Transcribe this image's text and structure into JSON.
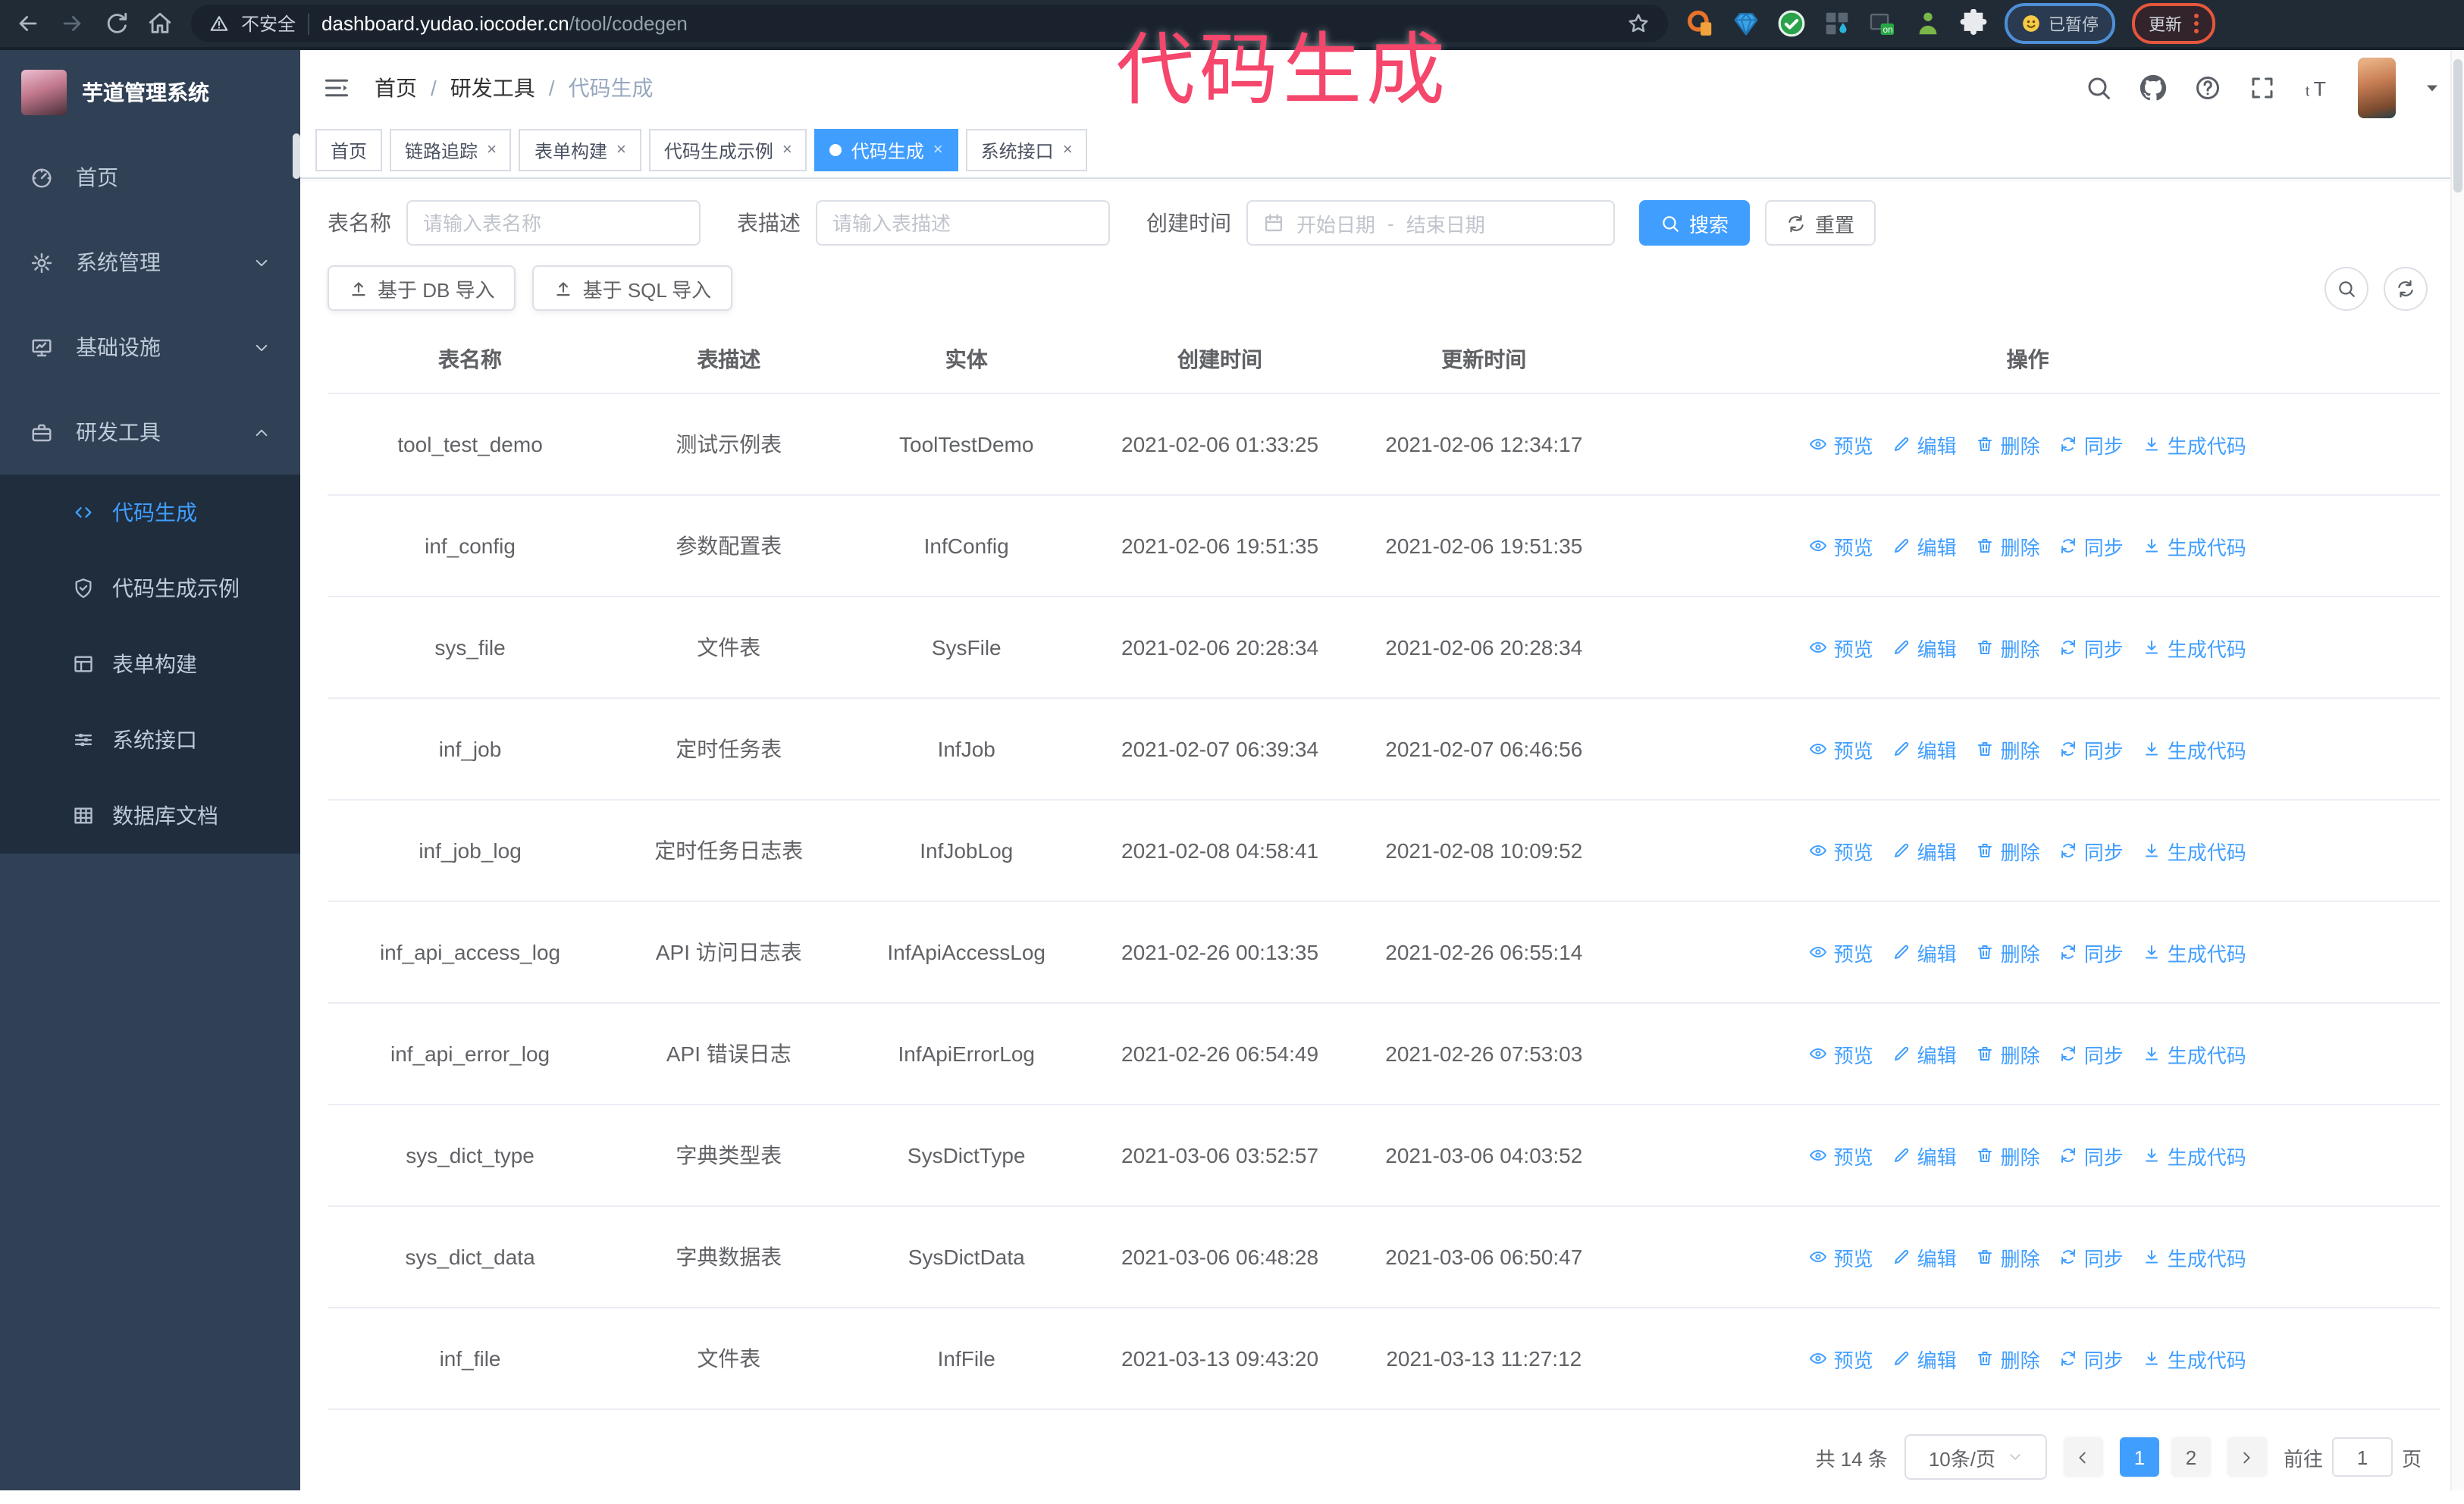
{
  "overlay": {
    "title": "代码生成"
  },
  "browser": {
    "security_label": "不安全",
    "url_host": "dashboard.yudao.iocoder.cn",
    "url_path": "/tool/codegen",
    "paused_badge": "已暂停",
    "update_button": "更新",
    "nav_icons": [
      "back-icon",
      "forward-icon",
      "reload-icon",
      "home-icon"
    ],
    "extension_icons": [
      "ext-orange-icon",
      "gem-icon",
      "check-badge-icon",
      "grid-drop-icon",
      "on-box-icon",
      "green-figure-icon",
      "puzzle-icon"
    ]
  },
  "sidebar": {
    "app_title": "芋道管理系统",
    "items": [
      {
        "key": "home",
        "label": "首页",
        "icon": "dashboard-icon",
        "chevron": ""
      },
      {
        "key": "system-mgmt",
        "label": "系统管理",
        "icon": "gear-icon",
        "chevron": "down"
      },
      {
        "key": "infrastructure",
        "label": "基础设施",
        "icon": "monitor-icon",
        "chevron": "down"
      },
      {
        "key": "dev-tools",
        "label": "研发工具",
        "icon": "toolbox-icon",
        "chevron": "up"
      }
    ],
    "subitems": [
      {
        "key": "codegen",
        "label": "代码生成",
        "icon": "code-icon",
        "active": true
      },
      {
        "key": "codegen-example",
        "label": "代码生成示例",
        "icon": "shield-check-icon",
        "active": false
      },
      {
        "key": "form-builder",
        "label": "表单构建",
        "icon": "form-icon",
        "active": false
      },
      {
        "key": "system-api",
        "label": "系统接口",
        "icon": "sliders-icon",
        "active": false
      },
      {
        "key": "db-doc",
        "label": "数据库文档",
        "icon": "database-icon",
        "active": false
      }
    ]
  },
  "header": {
    "breadcrumb": [
      "首页",
      "研发工具",
      "代码生成"
    ]
  },
  "tabs": [
    {
      "key": "home",
      "label": "首页",
      "closable": false,
      "active": false
    },
    {
      "key": "tracing",
      "label": "链路追踪",
      "closable": true,
      "active": false
    },
    {
      "key": "form-builder",
      "label": "表单构建",
      "closable": true,
      "active": false
    },
    {
      "key": "codegen-example",
      "label": "代码生成示例",
      "closable": true,
      "active": false
    },
    {
      "key": "codegen",
      "label": "代码生成",
      "closable": true,
      "active": true
    },
    {
      "key": "system-api",
      "label": "系统接口",
      "closable": true,
      "active": false
    }
  ],
  "filters": {
    "table_name_label": "表名称",
    "table_name_placeholder": "请输入表名称",
    "table_desc_label": "表描述",
    "table_desc_placeholder": "请输入表描述",
    "create_time_label": "创建时间",
    "start_placeholder": "开始日期",
    "range_separator": "-",
    "end_placeholder": "结束日期",
    "search_label": "搜索",
    "reset_label": "重置"
  },
  "toolbar": {
    "db_import_label": "基于 DB 导入",
    "sql_import_label": "基于 SQL 导入"
  },
  "table": {
    "headers": [
      "表名称",
      "表描述",
      "实体",
      "创建时间",
      "更新时间",
      "操作"
    ],
    "actions": [
      {
        "key": "preview",
        "label": "预览",
        "icon": "eye-icon"
      },
      {
        "key": "edit",
        "label": "编辑",
        "icon": "pencil-icon"
      },
      {
        "key": "delete",
        "label": "删除",
        "icon": "trash-icon"
      },
      {
        "key": "sync",
        "label": "同步",
        "icon": "sync-icon"
      },
      {
        "key": "generate-code",
        "label": "生成代码",
        "icon": "download-icon"
      }
    ],
    "rows": [
      {
        "name": "tool_test_demo",
        "desc": "测试示例表",
        "entity": "ToolTestDemo",
        "created": "2021-02-06 01:33:25",
        "updated": "2021-02-06 12:34:17"
      },
      {
        "name": "inf_config",
        "desc": "参数配置表",
        "entity": "InfConfig",
        "created": "2021-02-06 19:51:35",
        "updated": "2021-02-06 19:51:35"
      },
      {
        "name": "sys_file",
        "desc": "文件表",
        "entity": "SysFile",
        "created": "2021-02-06 20:28:34",
        "updated": "2021-02-06 20:28:34"
      },
      {
        "name": "inf_job",
        "desc": "定时任务表",
        "entity": "InfJob",
        "created": "2021-02-07 06:39:34",
        "updated": "2021-02-07 06:46:56"
      },
      {
        "name": "inf_job_log",
        "desc": "定时任务日志表",
        "entity": "InfJobLog",
        "created": "2021-02-08 04:58:41",
        "updated": "2021-02-08 10:09:52"
      },
      {
        "name": "inf_api_access_log",
        "desc": "API 访问日志表",
        "entity": "InfApiAccessLog",
        "created": "2021-02-26 00:13:35",
        "updated": "2021-02-26 06:55:14"
      },
      {
        "name": "inf_api_error_log",
        "desc": "API 错误日志",
        "entity": "InfApiErrorLog",
        "created": "2021-02-26 06:54:49",
        "updated": "2021-02-26 07:53:03"
      },
      {
        "name": "sys_dict_type",
        "desc": "字典类型表",
        "entity": "SysDictType",
        "created": "2021-03-06 03:52:57",
        "updated": "2021-03-06 04:03:52"
      },
      {
        "name": "sys_dict_data",
        "desc": "字典数据表",
        "entity": "SysDictData",
        "created": "2021-03-06 06:48:28",
        "updated": "2021-03-06 06:50:47"
      },
      {
        "name": "inf_file",
        "desc": "文件表",
        "entity": "InfFile",
        "created": "2021-03-13 09:43:20",
        "updated": "2021-03-13 11:27:12"
      }
    ]
  },
  "pagination": {
    "total_label": "共 14 条",
    "page_size_label": "10条/页",
    "pages": [
      "1",
      "2"
    ],
    "active_page": "1",
    "goto_label": "前往",
    "goto_value": "1",
    "page_unit_label": "页"
  },
  "colors": {
    "accent": "#409eff",
    "sidebar_bg": "#304156",
    "submenu_bg": "#1f2d3d",
    "chrome_bg": "#212b36",
    "overlay_pink": "#f5466c",
    "link": "#409eff",
    "paused_badge_border": "#4d8fd6",
    "update_button_border": "#e4573d",
    "row_border": "#ebeef5"
  }
}
